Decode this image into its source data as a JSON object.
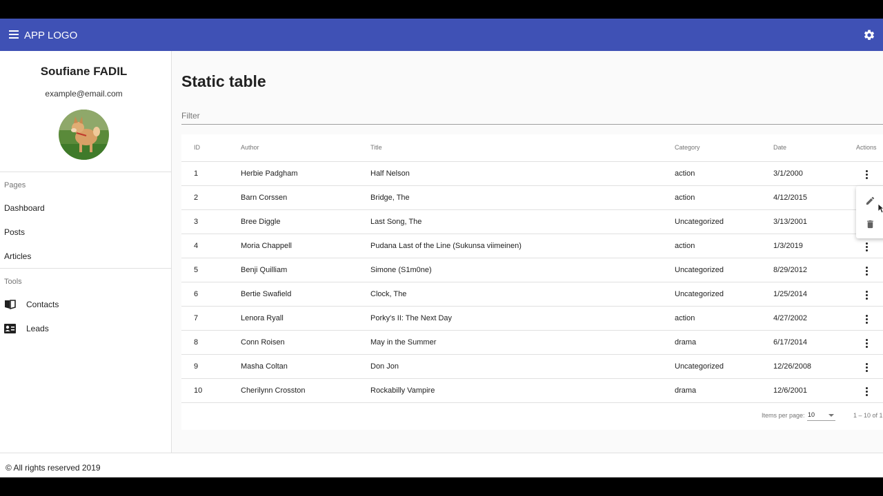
{
  "app": {
    "logo_text": "APP LOGO",
    "menu_icon": "menu-icon",
    "settings_icon": "gear-icon",
    "brand_color": "#3f51b5"
  },
  "user": {
    "name": "Soufiane FADIL",
    "email": "example@email.com",
    "avatar_icon": "dog-avatar"
  },
  "sidebar": {
    "pages_title": "Pages",
    "pages": [
      {
        "label": "Dashboard"
      },
      {
        "label": "Posts"
      },
      {
        "label": "Articles"
      }
    ],
    "tools_title": "Tools",
    "tools": [
      {
        "label": "Contacts",
        "icon": "book-icon"
      },
      {
        "label": "Leads",
        "icon": "contact-card-icon"
      }
    ]
  },
  "main": {
    "title": "Static table",
    "filter_placeholder": "Filter",
    "columns": {
      "id": "ID",
      "author": "Author",
      "title": "Title",
      "category": "Category",
      "date": "Date",
      "actions": "Actions"
    },
    "rows": [
      {
        "id": "1",
        "author": "Herbie Padgham",
        "title": "Half Nelson",
        "category": "action",
        "date": "3/1/2000"
      },
      {
        "id": "2",
        "author": "Barn Corssen",
        "title": "Bridge, The",
        "category": "action",
        "date": "4/12/2015"
      },
      {
        "id": "3",
        "author": "Bree Diggle",
        "title": "Last Song, The",
        "category": "Uncategorized",
        "date": "3/13/2001"
      },
      {
        "id": "4",
        "author": "Moria Chappell",
        "title": "Pudana Last of the Line (Sukunsa viimeinen)",
        "category": "action",
        "date": "1/3/2019"
      },
      {
        "id": "5",
        "author": "Benji Quilliam",
        "title": "Simone (S1m0ne)",
        "category": "Uncategorized",
        "date": "8/29/2012"
      },
      {
        "id": "6",
        "author": "Bertie Swafield",
        "title": "Clock, The",
        "category": "Uncategorized",
        "date": "1/25/2014"
      },
      {
        "id": "7",
        "author": "Lenora Ryall",
        "title": "Porky's II: The Next Day",
        "category": "action",
        "date": "4/27/2002"
      },
      {
        "id": "8",
        "author": "Conn Roisen",
        "title": "May in the Summer",
        "category": "drama",
        "date": "6/17/2014"
      },
      {
        "id": "9",
        "author": "Masha Coltan",
        "title": "Don Jon",
        "category": "Uncategorized",
        "date": "12/26/2008"
      },
      {
        "id": "10",
        "author": "Cherilynn Crosston",
        "title": "Rockabilly Vampire",
        "category": "drama",
        "date": "12/6/2001"
      }
    ],
    "row_actions_icon": "more-vert-icon",
    "action_menu": {
      "open_for_row": "2",
      "items": [
        {
          "icon": "edit-icon"
        },
        {
          "icon": "delete-icon"
        }
      ]
    },
    "paginator": {
      "items_per_page_label": "Items per page:",
      "page_size": "10",
      "range": "1 – 10 of 1"
    }
  },
  "footer": {
    "text": "© All rights reserved 2019"
  }
}
